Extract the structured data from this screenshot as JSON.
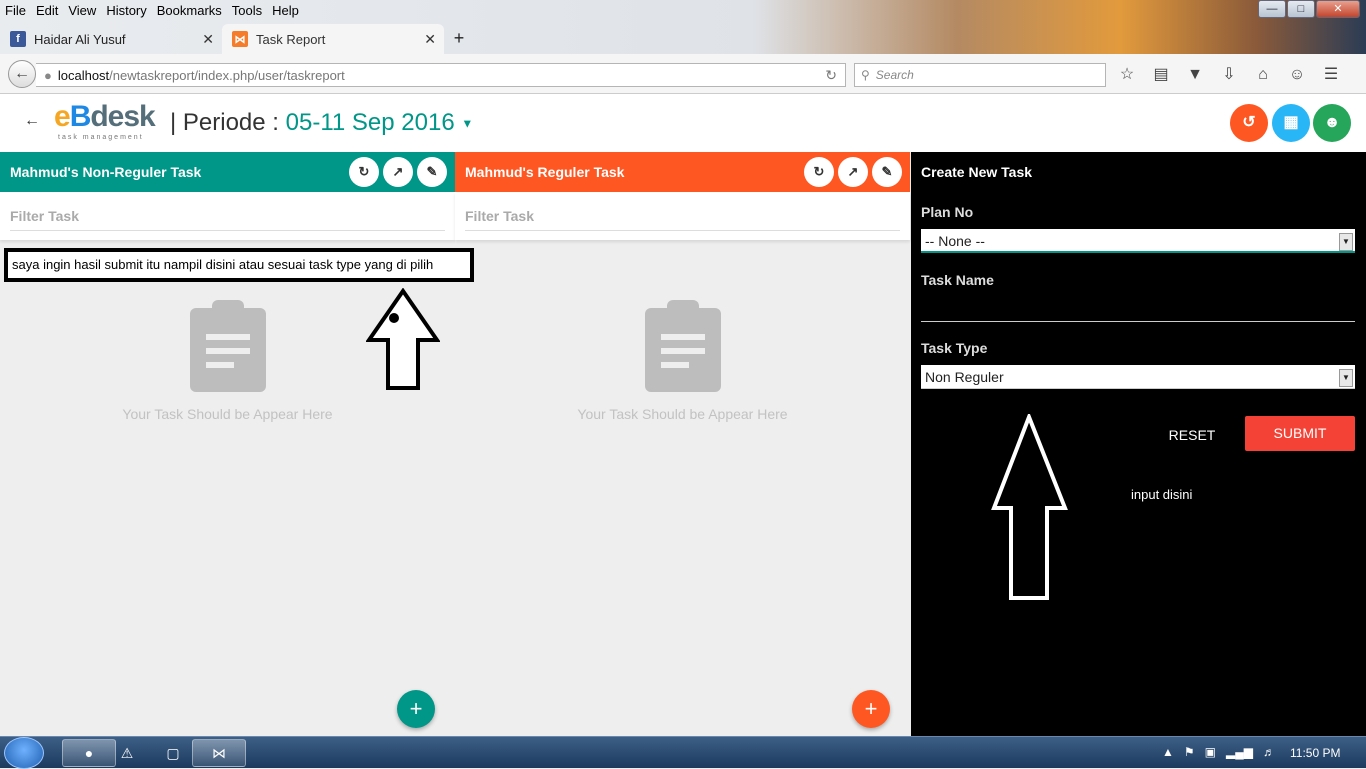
{
  "browser": {
    "menu": [
      "File",
      "Edit",
      "View",
      "History",
      "Bookmarks",
      "Tools",
      "Help"
    ],
    "tabs": [
      {
        "title": "Haidar Ali Yusuf",
        "favicon": "facebook-icon"
      },
      {
        "title": "Task Report",
        "favicon": "xampp-icon"
      }
    ],
    "url_host": "localhost",
    "url_path": "/newtaskreport/index.php/user/taskreport",
    "search_placeholder": "Search"
  },
  "app": {
    "logo_text_e": "e",
    "logo_text_b": "B",
    "logo_text_desk": "desk",
    "logo_sub": "task management",
    "periode_label": "| Periode :",
    "periode_value": "05-11 Sep 2016",
    "header_buttons": [
      {
        "name": "history-icon",
        "color": "#ff5722"
      },
      {
        "name": "clipboard-icon",
        "color": "#29b6f6"
      },
      {
        "name": "account-icon",
        "color": "#26a65b"
      }
    ]
  },
  "panels": [
    {
      "title": "Mahmud's Non-Reguler Task",
      "color": "#009688",
      "filter_placeholder": "Filter Task",
      "empty_text": "Your Task Should be Appear Here",
      "fab": "+"
    },
    {
      "title": "Mahmud's Reguler Task",
      "color": "#ff5722",
      "filter_placeholder": "Filter Task",
      "empty_text": "Your Task Should be Appear Here",
      "fab": "+"
    }
  ],
  "annotation": "saya ingin hasil submit itu nampil disini atau sesuai task type yang di pilih",
  "sidebar": {
    "title": "Create New Task",
    "plan_label": "Plan No",
    "plan_value": "-- None --",
    "task_name_label": "Task Name",
    "task_name_value": "",
    "task_type_label": "Task Type",
    "task_type_value": "Non Reguler",
    "reset_label": "RESET",
    "submit_label": "SUBMIT",
    "note": "input disini"
  },
  "taskbar": {
    "clock": "11:50 PM"
  }
}
